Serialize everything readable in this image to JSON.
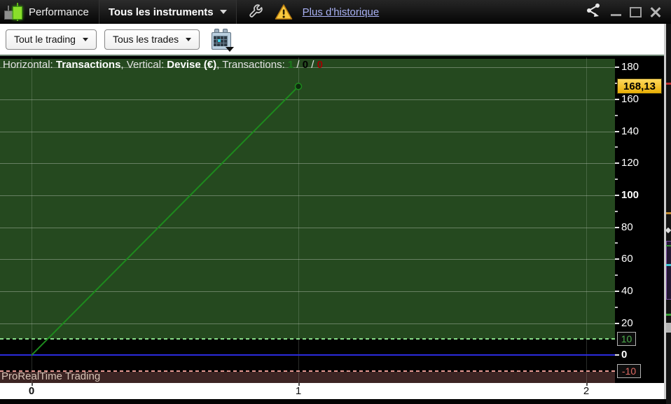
{
  "window": {
    "title": "Performance",
    "instruments_menu": "Tous les instruments",
    "history_link": "Plus d'historique",
    "icons": [
      "candlestick-icon",
      "wrench-icon",
      "warning-icon",
      "share-icon",
      "minimize-icon",
      "maximize-icon",
      "close-icon"
    ]
  },
  "toolbar": {
    "trading_filter": "Tout le trading",
    "trades_filter": "Tous les trades",
    "calendar_icon": "calendar-icon"
  },
  "legend": {
    "h_label": "Horizontal:",
    "h_value": "Transactions",
    "sep1": ", ",
    "v_label": "Vertical:",
    "v_value": "Devise (€)",
    "sep2": ", ",
    "t_label": "Transactions:",
    "wins": "1",
    "slash1": " / ",
    "flat": "0",
    "slash2": " / ",
    "losses": "0"
  },
  "watermark": "ProRealTime Trading",
  "chart_data": {
    "type": "line",
    "title": "Equity curve by transaction",
    "xlabel": "Transactions",
    "ylabel": "Devise (€)",
    "x": [
      0,
      1
    ],
    "values": [
      0,
      168.13
    ],
    "current_value_label": "168,13",
    "x_ticks": [
      "0",
      "1",
      "2"
    ],
    "x_ticks_bold": [
      "0"
    ],
    "y_ticks_major": [
      180,
      160,
      140,
      120,
      100,
      80,
      60,
      40,
      20,
      0
    ],
    "y_ticks_bold": [
      100,
      0
    ],
    "y_ticks_minor": [
      170,
      150,
      130,
      110,
      90,
      70,
      50,
      30
    ],
    "upper_threshold": 10,
    "upper_threshold_label": "10",
    "lower_threshold": -10,
    "lower_threshold_label": "-10",
    "ylim": [
      -17.5,
      184
    ],
    "grid": true,
    "colors": {
      "gain_zone": "#25491f",
      "loss_zone": "#3c2423",
      "line": "#1d8a1d",
      "zero_line": "#2b2bdc",
      "upper_dash": "#8ade8a",
      "lower_dash": "#e89b94",
      "current_badge": "#f2c028",
      "upper_badge_text": "#4db04d",
      "lower_badge_text": "#e06b64"
    }
  }
}
